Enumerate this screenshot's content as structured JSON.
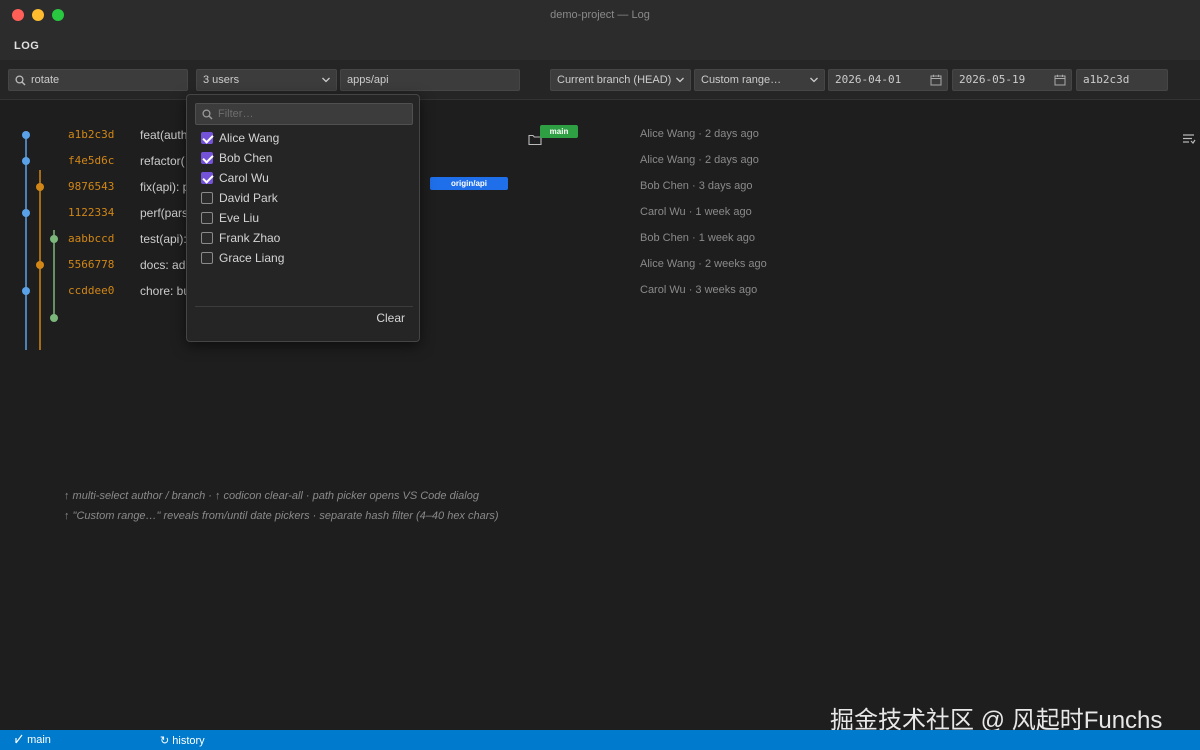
{
  "window": {
    "title": "demo-project — Log"
  },
  "panel": {
    "title": "LOG"
  },
  "toolbar": {
    "search_value": "rotate",
    "users_value": "3 users",
    "path_value": "apps/api",
    "branch_value": "Current branch (HEAD)",
    "range_value": "Custom range…",
    "from_date": "2026-04-01",
    "until_date": "2026-05-19",
    "hash_value": "a1b2c3d"
  },
  "commits": [
    {
      "hash": "a1b2c3d",
      "message": "feat(auth",
      "meta": "Alice Wang · 2 days ago",
      "ref": "main"
    },
    {
      "hash": "f4e5d6c",
      "message": "refactor(",
      "meta": "Alice Wang · 2 days ago",
      "ref": ""
    },
    {
      "hash": "9876543",
      "message": "fix(api): p",
      "meta": "Bob Chen · 3 days ago",
      "ref": "origin/api"
    },
    {
      "hash": "1122334",
      "message": "perf(pars",
      "meta": "Carol Wu · 1 week ago",
      "ref": ""
    },
    {
      "hash": "aabbccd",
      "message": "test(api):",
      "meta": "Bob Chen · 1 week ago",
      "ref": ""
    },
    {
      "hash": "5566778",
      "message": "docs: ad",
      "meta": "Alice Wang · 2 weeks ago",
      "ref": ""
    },
    {
      "hash": "ccddee0",
      "message": "chore: bu",
      "meta": "Carol Wu · 3 weeks ago",
      "ref": ""
    }
  ],
  "dropdown": {
    "filter_placeholder": "Filter…",
    "users": [
      {
        "name": "Alice Wang",
        "checked": true
      },
      {
        "name": "Bob Chen",
        "checked": true
      },
      {
        "name": "Carol Wu",
        "checked": true
      },
      {
        "name": "David Park",
        "checked": false
      },
      {
        "name": "Eve Liu",
        "checked": false
      },
      {
        "name": "Frank Zhao",
        "checked": false
      },
      {
        "name": "Grace Liang",
        "checked": false
      }
    ],
    "clear_label": "Clear"
  },
  "notes": {
    "line1": "↑ multi-select author / branch · ↑ codicon clear-all · path picker opens VS Code dialog",
    "line2": "↑ \"Custom range…\" reveals from/until date pickers · separate hash filter (4–40 hex chars)"
  },
  "watermark": "掘金技术社区 @ 风起时Funchs",
  "statusbar": {
    "branch_label": "main",
    "history_label": "history"
  },
  "colors": {
    "lane_blue": "#5aa2e8",
    "lane_orange": "#d18616",
    "lane_green": "#7bb77b",
    "accent_checkbox": "#7553d8",
    "statusbar_bg": "#007acc",
    "badge_main": "#2ea043",
    "badge_api": "#1f6feb"
  }
}
